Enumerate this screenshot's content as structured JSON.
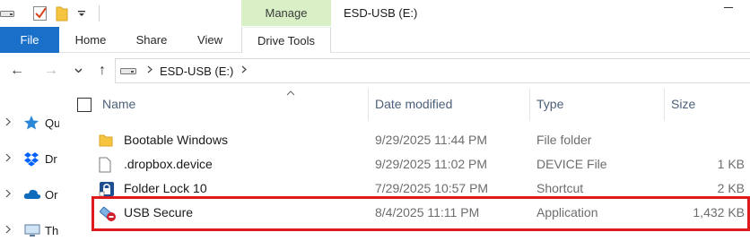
{
  "window": {
    "title": "ESD-USB (E:)",
    "context_tab": "Manage",
    "quick_access_icons": [
      "drive-icon",
      "properties-check-icon",
      "new-folder-icon",
      "customize-arrow-icon"
    ]
  },
  "ribbon": {
    "tabs": [
      {
        "label": "File",
        "active": true
      },
      {
        "label": "Home"
      },
      {
        "label": "Share"
      },
      {
        "label": "View"
      },
      {
        "label": "Drive Tools"
      }
    ]
  },
  "address": {
    "path_label": "ESD-USB (E:)",
    "back_glyph": "←",
    "forward_glyph": "→",
    "recent_glyph": "⌄",
    "up_glyph": "↑"
  },
  "navpane": {
    "items": [
      {
        "label": "Qu",
        "icon": "star-icon"
      },
      {
        "label": "Dr",
        "icon": "dropbox-icon"
      },
      {
        "label": "Or",
        "icon": "onedrive-icon"
      },
      {
        "label": "Th",
        "icon": "this-pc-icon"
      }
    ]
  },
  "columns": {
    "name": "Name",
    "date_modified": "Date modified",
    "type": "Type",
    "size": "Size"
  },
  "files": [
    {
      "name": "Bootable Windows",
      "date": "9/29/2025 11:44 PM",
      "type": "File folder",
      "size": "",
      "icon": "folder-icon"
    },
    {
      "name": ".dropbox.device",
      "date": "9/29/2025 11:02 PM",
      "type": "DEVICE File",
      "size": "1 KB",
      "icon": "file-icon"
    },
    {
      "name": "Folder Lock 10",
      "date": "7/29/2025 10:57 PM",
      "type": "Shortcut",
      "size": "2 KB",
      "icon": "folder-lock-shortcut-icon"
    },
    {
      "name": "USB Secure",
      "date": "8/4/2025 11:11 PM",
      "type": "Application",
      "size": "1,432 KB",
      "icon": "usb-secure-app-icon",
      "highlighted": true
    }
  ],
  "colors": {
    "file_tab": "#1a6fc9",
    "manage_tab": "#d9f0c6",
    "highlight": "#e0191d",
    "folder": "#f5c542"
  }
}
